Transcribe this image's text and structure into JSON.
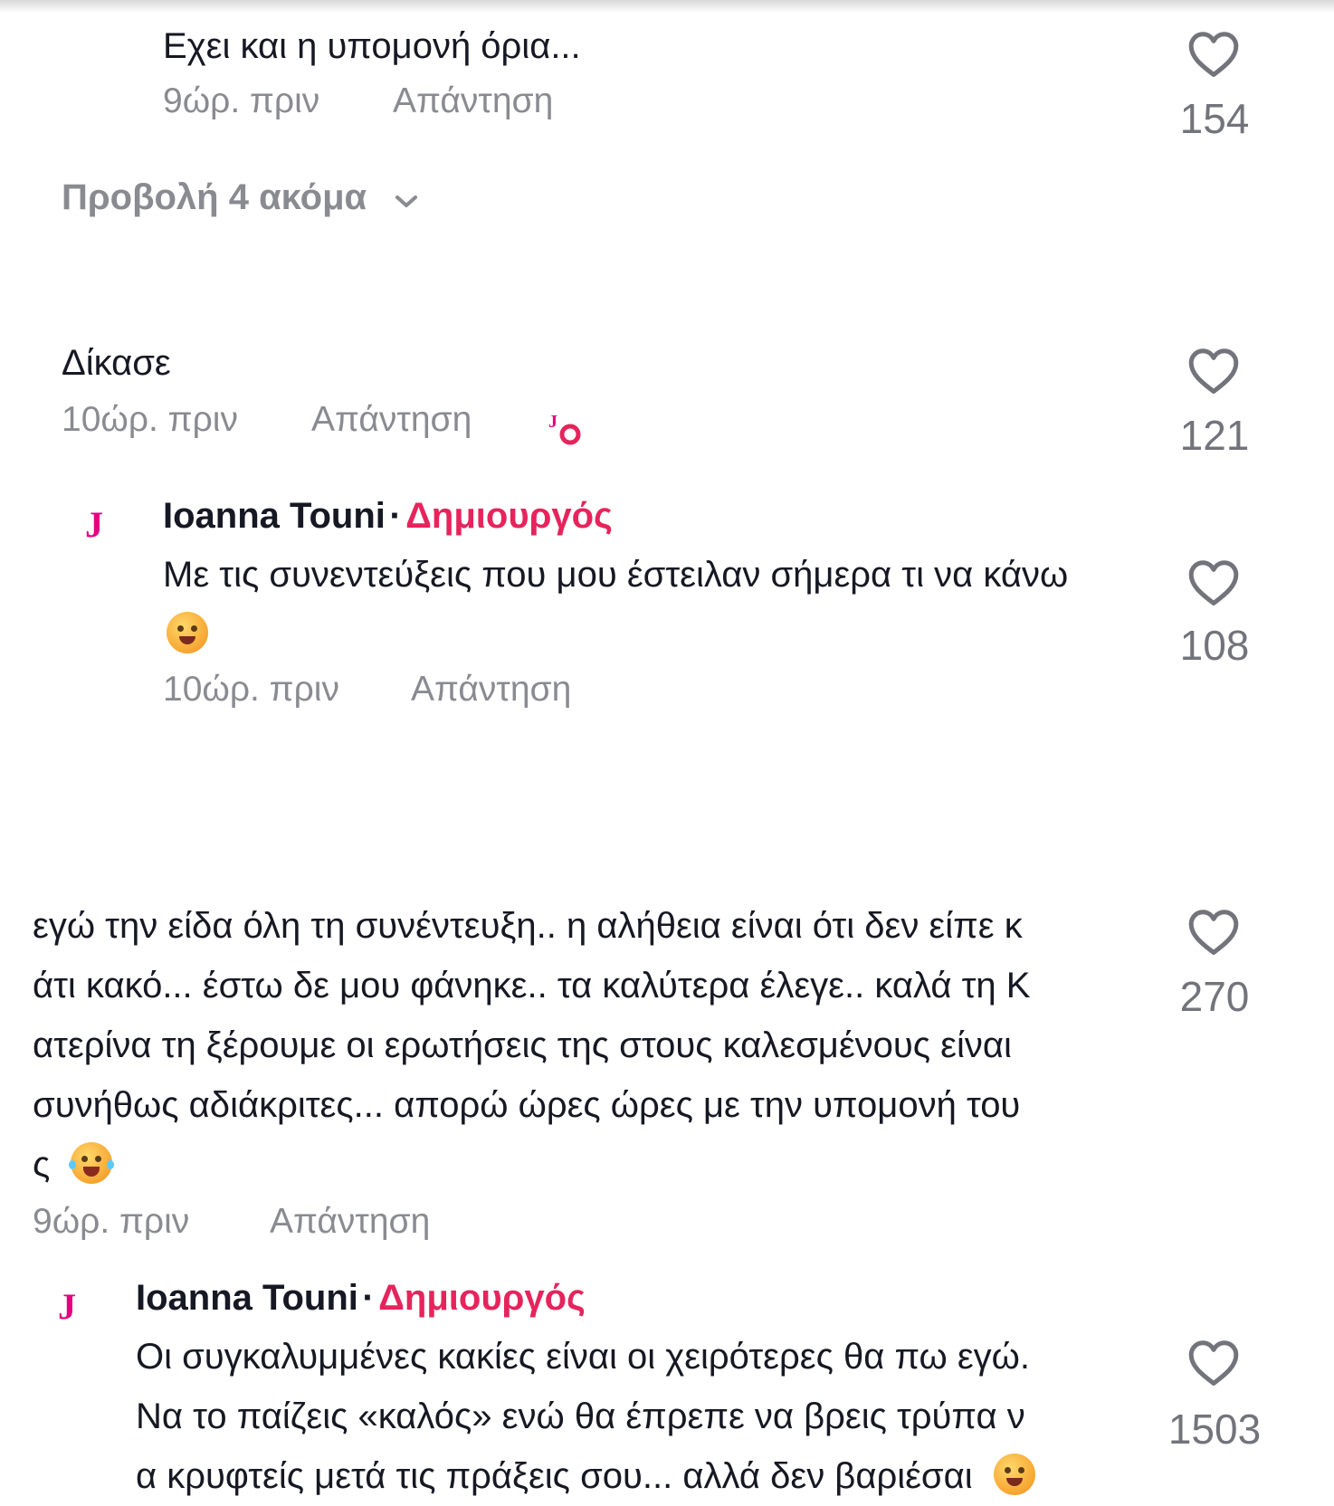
{
  "colors": {
    "creator_badge": "#e6245c",
    "avatar_logo": "#e5007e",
    "meta_gray": "#8a8b91",
    "count_gray": "#73747b",
    "text_dark": "#161823"
  },
  "comments": [
    {
      "id": "c0",
      "text": "Εχει και η υπομονή όρια...",
      "time": "9ώρ. πριν",
      "reply_label": "Απάντηση",
      "likes": "154",
      "icon": "heart-outline-icon"
    },
    {
      "id": "c1",
      "view_more": "Προβολή 4 ακόμα",
      "view_more_icon": "chevron-down-icon"
    },
    {
      "id": "c2",
      "text": "Δίκασε",
      "time": "10ώρ. πριν",
      "reply_label": "Απάντηση",
      "likes": "121",
      "liked_by_creator_icon": "creator-liked-icon"
    },
    {
      "id": "c3",
      "author": "Ioanna Touni",
      "separator": "·",
      "badge": "Δημιουργός",
      "avatar_letter": "J",
      "text_line1": "Με τις συνεντεύξεις που μου έστειλαν σήμερα τι να κάνω",
      "emoji": "drooling-face-emoji",
      "time": "10ώρ. πριν",
      "reply_label": "Απάντηση",
      "likes": "108"
    },
    {
      "id": "c4",
      "text_lines": [
        "εγώ την είδα όλη τη συνέντευξη.. η αλήθεια είναι ότι δεν είπε κ",
        "άτι κακό... έστω δε μου φάνηκε.. τα καλύτερα έλεγε.. καλά τη Κ",
        "ατερίνα τη ξέρουμε οι ερωτήσεις της στους καλεσμένους είναι",
        "συνήθως αδιάκριτες... απορώ ώρες ώρες με την υπομονή του",
        "ς"
      ],
      "emoji": "laughing-tears-emoji",
      "time": "9ώρ. πριν",
      "reply_label": "Απάντηση",
      "likes": "270"
    },
    {
      "id": "c5",
      "author": "Ioanna Touni",
      "separator": "·",
      "badge": "Δημιουργός",
      "avatar_letter": "J",
      "text_lines": [
        "Οι συγκαλυμμένες κακίες είναι οι χειρότερες θα πω εγώ.",
        "Να το παίζεις «καλός» ενώ θα έπρεπε να βρεις τρύπα ν",
        "α κρυφτείς μετά τις πράξεις σου... αλλά δεν βαριέσαι"
      ],
      "emoji": "drooling-face-emoji",
      "likes": "1503"
    }
  ]
}
